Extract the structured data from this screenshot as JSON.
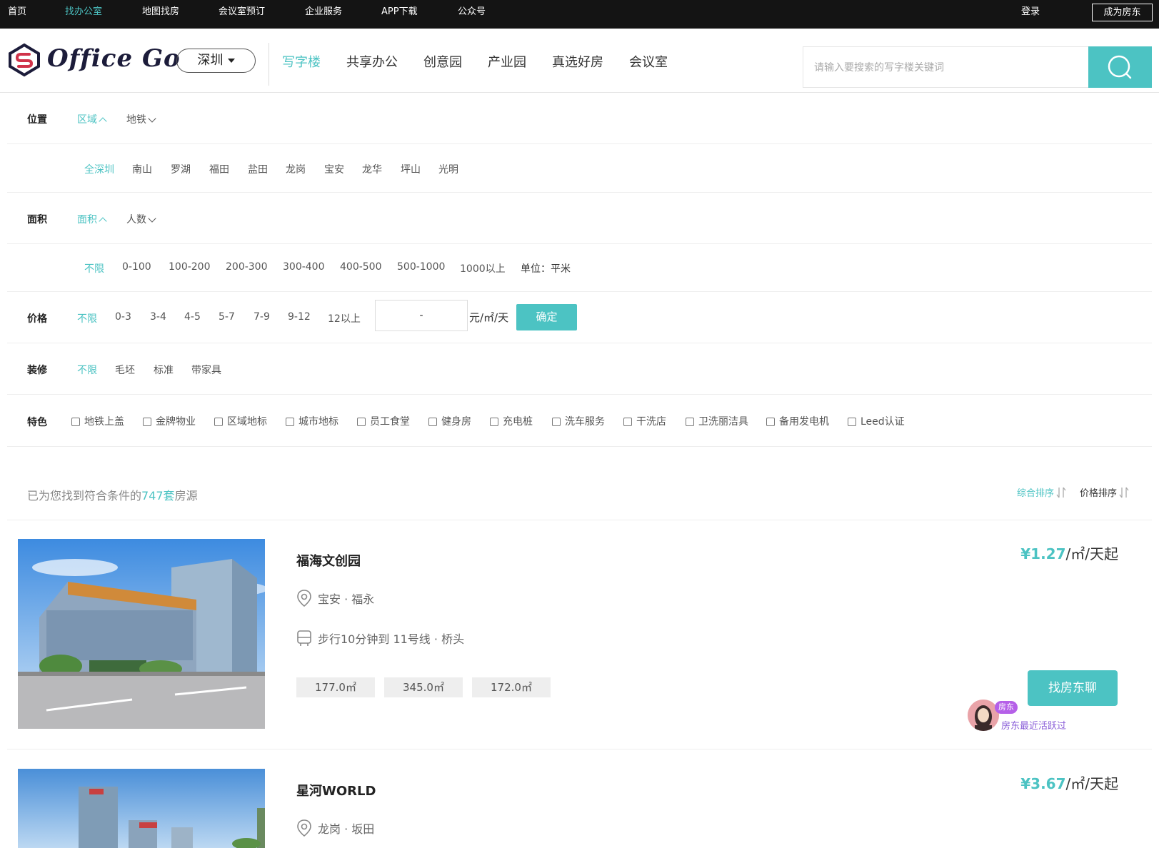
{
  "topbar": {
    "items": [
      "首页",
      "找办公室",
      "地图找房",
      "会议室预订",
      "企业服务",
      "APP下载",
      "公众号"
    ],
    "active_index": 1,
    "login": "登录",
    "become_landlord": "成为房东"
  },
  "header": {
    "logo": "Office Go",
    "city": "深圳",
    "nav": [
      "写字楼",
      "共享办公",
      "创意园",
      "产业园",
      "真选好房",
      "会议室"
    ],
    "active_nav": 0,
    "search_placeholder": "请输入要搜索的写字楼关键词"
  },
  "filters": {
    "location": {
      "label": "位置",
      "tabs": [
        "区域",
        "地铁"
      ],
      "areas": [
        "全深圳",
        "南山",
        "罗湖",
        "福田",
        "盐田",
        "龙岗",
        "宝安",
        "龙华",
        "坪山",
        "光明"
      ]
    },
    "size": {
      "label": "面积",
      "tabs": [
        "面积",
        "人数"
      ],
      "ranges": [
        "不限",
        "0-100",
        "100-200",
        "200-300",
        "300-400",
        "400-500",
        "500-1000",
        "1000以上"
      ],
      "unit": "单位：平米"
    },
    "price": {
      "label": "价格",
      "ranges": [
        "不限",
        "0-3",
        "3-4",
        "4-5",
        "5-7",
        "7-9",
        "9-12",
        "12以上"
      ],
      "input_value": "-",
      "unit": "元/㎡/天",
      "confirm": "确定"
    },
    "decoration": {
      "label": "装修",
      "options": [
        "不限",
        "毛坯",
        "标准",
        "带家具"
      ]
    },
    "features": {
      "label": "特色",
      "options": [
        "地铁上盖",
        "金牌物业",
        "区域地标",
        "城市地标",
        "员工食堂",
        "健身房",
        "充电桩",
        "洗车服务",
        "干洗店",
        "卫洗丽洁具",
        "备用发电机",
        "Leed认证"
      ]
    }
  },
  "results": {
    "prefix": "已为您找到符合条件的",
    "count": "747套",
    "suffix": "房源",
    "sort_default": "综合排序",
    "sort_price": "价格排序"
  },
  "listings": [
    {
      "name": "福海文创园",
      "location": "宝安 · 福永",
      "transit": "步行10分钟到 11号线 · 桥头",
      "sizes": [
        "177.0㎡",
        "345.0㎡",
        "172.0㎡"
      ],
      "price": "¥1.27",
      "price_unit": "/㎡/天起",
      "chat_button": "找房东聊",
      "landlord_badge": "房东",
      "landlord_status": "房东最近活跃过"
    },
    {
      "name": "星河WORLD",
      "location": "龙岗 · 坂田",
      "price": "¥3.67",
      "price_unit": "/㎡/天起"
    }
  ],
  "colors": {
    "accent": "#4cc3c3",
    "topbar": "#141414",
    "landlord": "#b560e8"
  }
}
